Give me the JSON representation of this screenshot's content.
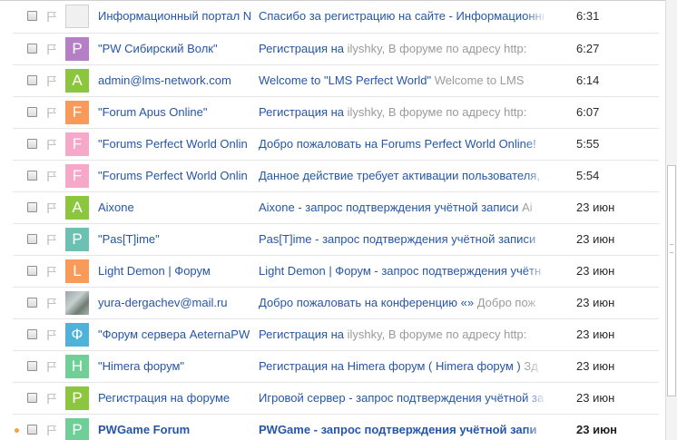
{
  "colors": {
    "sender_link": "#2556a6",
    "snippet_gray": "#9a9a9a",
    "unread_dot": "#f0a44a"
  },
  "messages": [
    {
      "sender": "Информационный портал N",
      "avatar": {
        "letter": "",
        "color": "#f0f0f0",
        "kind": "gray"
      },
      "subject": "Спасибо за регистрацию на сайте - Информационный",
      "snippet": "",
      "time": "6:31",
      "unread": false
    },
    {
      "sender": "\"PW Сибирский Волк\"",
      "avatar": {
        "letter": "P",
        "color": "#b57fc6",
        "kind": "letter"
      },
      "subject": "Регистрация на",
      "snippet": " ilyshky, В форуме по адресу http:",
      "time": "6:27",
      "unread": false
    },
    {
      "sender": "admin@lms-network.com",
      "avatar": {
        "letter": "A",
        "color": "#8cc63f",
        "kind": "letter"
      },
      "subject": "Welcome to \"LMS Perfect World\"",
      "snippet": " Welcome to LMS",
      "time": "6:14",
      "unread": false
    },
    {
      "sender": "\"Forum Apus Online\"",
      "avatar": {
        "letter": "F",
        "color": "#f79a5a",
        "kind": "letter"
      },
      "subject": "Регистрация на",
      "snippet": " ilyshky, В форуме по адресу http:",
      "time": "6:07",
      "unread": false
    },
    {
      "sender": "\"Forums Perfect World Onlin",
      "avatar": {
        "letter": "F",
        "color": "#f5a8c8",
        "kind": "letter"
      },
      "subject": "Добро пожаловать на Forums Perfect World Online!",
      "snippet": "",
      "time": "5:55",
      "unread": false
    },
    {
      "sender": "\"Forums Perfect World Onlin",
      "avatar": {
        "letter": "F",
        "color": "#f5a8c8",
        "kind": "letter"
      },
      "subject": "Данное действие требует активации пользователя, :",
      "snippet": "",
      "time": "5:54",
      "unread": false
    },
    {
      "sender": "Aixone",
      "avatar": {
        "letter": "A",
        "color": "#8cc63f",
        "kind": "letter"
      },
      "subject": "Aixone - запрос подтверждения учётной записи",
      "snippet": " Ai",
      "time": "23 июн",
      "unread": false
    },
    {
      "sender": "\"Pas[T]ime\"",
      "avatar": {
        "letter": "P",
        "color": "#6cc1b2",
        "kind": "letter"
      },
      "subject": "Pas[T]ime - запрос подтверждения учётной записи",
      "snippet": "",
      "time": "23 июн",
      "unread": false
    },
    {
      "sender": "Light Demon | Форум",
      "avatar": {
        "letter": "L",
        "color": "#f79a5a",
        "kind": "letter"
      },
      "subject": "Light Demon | Форум - запрос подтверждения учётн",
      "snippet": "",
      "time": "23 июн",
      "unread": false
    },
    {
      "sender": "yura-dergachev@mail.ru",
      "avatar": {
        "letter": "",
        "color": "#a0aaa6",
        "kind": "photo"
      },
      "subject": "Добро пожаловать на конференцию «»",
      "snippet": " Добро пож",
      "time": "23 июн",
      "unread": false
    },
    {
      "sender": "\"Форум сервера AeternaPW",
      "avatar": {
        "letter": "Ф",
        "color": "#4fb3d9",
        "kind": "letter"
      },
      "subject": "Регистрация на",
      "snippet": " ilyshky, В форуме по адресу http:",
      "time": "23 июн",
      "unread": false
    },
    {
      "sender": "\"Himera форум\"",
      "avatar": {
        "letter": "H",
        "color": "#6fcf97",
        "kind": "letter"
      },
      "subject": "Регистрация на Himera форум ( Himera форум )",
      "snippet": " Зд",
      "time": "23 июн",
      "unread": false
    },
    {
      "sender": "Регистрация на форуме",
      "avatar": {
        "letter": "P",
        "color": "#8cc63f",
        "kind": "letter"
      },
      "subject": "Игровой сервер - запрос подтверждения учётной за",
      "snippet": "",
      "time": "23 июн",
      "unread": false
    },
    {
      "sender": "PWGame Forum",
      "avatar": {
        "letter": "P",
        "color": "#6fcf97",
        "kind": "letter"
      },
      "subject": "PWGame - запрос подтверждения учётной запи",
      "snippet": "",
      "time": "23 июн",
      "unread": true
    }
  ]
}
